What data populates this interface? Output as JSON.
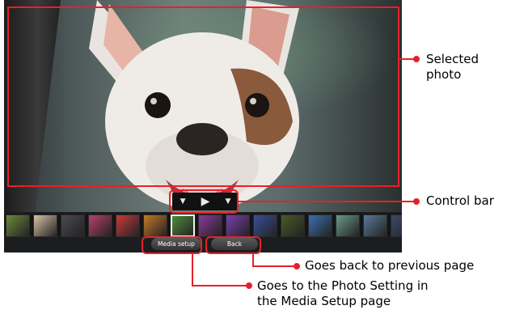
{
  "player": {
    "buttons": {
      "media_setup": "Media setup",
      "back": "Back"
    },
    "controls": {
      "prev_icon": "▼",
      "play_icon": "▶",
      "next_icon": "▼"
    },
    "thumbnail_colors": [
      "#6b8a3a",
      "#d6c2a4",
      "#4a4a52",
      "#b8426a",
      "#c93a3a",
      "#c47a2a",
      "#4f8f3b",
      "#8a3a9a",
      "#7a3fb0",
      "#3b4f9a",
      "#4a5a2a",
      "#3b6fb0",
      "#6a9a8a",
      "#5a7a9a",
      "#3a4a6a"
    ],
    "selected_thumbnail_index": 6
  },
  "annotations": {
    "selected_photo": "Selected\nphoto",
    "control_bar": "Control bar",
    "back": "Goes back to previous page",
    "media_setup_line1": "Goes to the Photo Setting in",
    "media_setup_line2": "the Media Setup page"
  },
  "colors": {
    "annotation": "#e8202a"
  }
}
